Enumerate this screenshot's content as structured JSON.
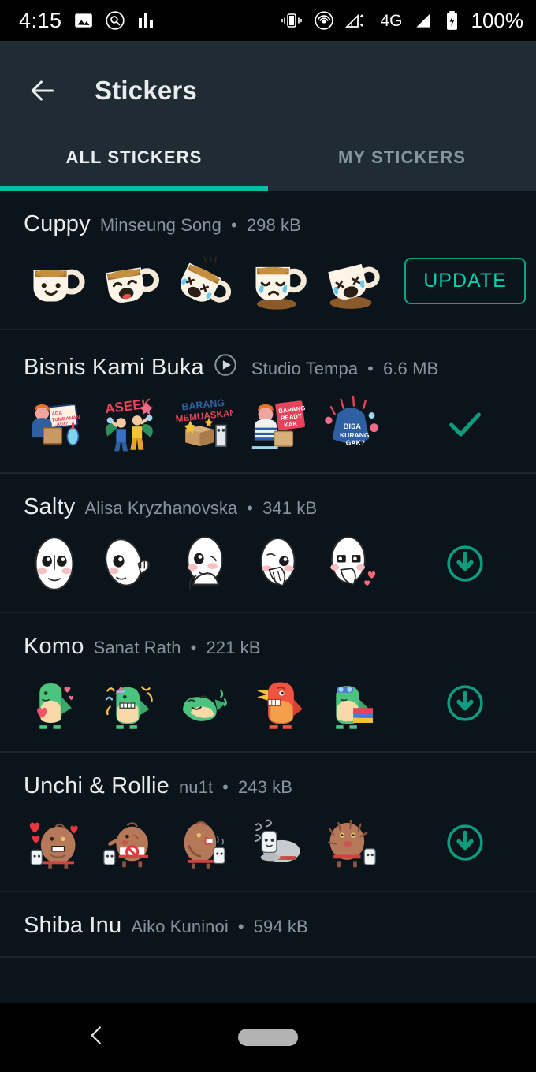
{
  "statusbar": {
    "time": "4:15",
    "battery_percent": "100%",
    "network_type": "4G",
    "left_icons": [
      "photo-icon",
      "search-circle-icon",
      "bar-chart-icon"
    ],
    "right_icons": [
      "vibrate-icon",
      "hotspot-icon",
      "signal-off-icon",
      "network-4g-label",
      "signal-bars-icon",
      "battery-charging-icon"
    ]
  },
  "appbar": {
    "back_icon": "arrow-left-icon",
    "title": "Stickers"
  },
  "tabs": {
    "active_index": 0,
    "items": [
      {
        "label": "ALL STICKERS"
      },
      {
        "label": "MY STICKERS"
      }
    ],
    "indicator_color": "#00bfa5"
  },
  "colors": {
    "background": "#0b141a",
    "appbar": "#1f2c34",
    "accent": "#00a884",
    "accent_bright": "#00d2b0",
    "title_text": "#e9edef",
    "meta_text": "#8696a0",
    "divider": "#1b262c"
  },
  "packs": [
    {
      "title": "Cuppy",
      "author": "Minseung Song",
      "size": "298 kB",
      "separator": "•",
      "animated": false,
      "action": "update",
      "action_label": "UPDATE",
      "stickers": [
        "cup-smiling",
        "cup-laughing",
        "cup-tipping",
        "cup-crying",
        "cup-spilled"
      ]
    },
    {
      "title": "Bisnis Kami Buka",
      "author": "Studio Tempa",
      "size": "6.6 MB",
      "separator": "•",
      "animated": true,
      "action": "added",
      "action_label": "",
      "stickers": [
        "ada-tumbahan-lagi",
        "aseek",
        "barang-memuaskan",
        "barang-ready-kak",
        "bisa-kurang-gak"
      ]
    },
    {
      "title": "Salty",
      "author": "Alisa Kryzhanovska",
      "size": "341 kB",
      "separator": "•",
      "animated": false,
      "action": "download",
      "action_label": "",
      "stickers": [
        "face-neutral",
        "face-waving",
        "face-thinking",
        "face-shy",
        "face-hearts"
      ]
    },
    {
      "title": "Komo",
      "author": "Sanat Rath",
      "size": "221 kB",
      "separator": "•",
      "animated": false,
      "action": "download",
      "action_label": "",
      "stickers": [
        "dino-love",
        "dino-party",
        "dino-rolling",
        "dino-angry-red",
        "dino-books"
      ]
    },
    {
      "title": "Unchi & Rollie",
      "author": "nu1t",
      "size": "243 kB",
      "separator": "•",
      "animated": false,
      "action": "download",
      "action_label": "",
      "stickers": [
        "unchi-hearts",
        "unchi-no-sign",
        "unchi-shouting",
        "rollie-sleeping",
        "unchi-shocked"
      ]
    },
    {
      "title": "Shiba Inu",
      "author": "Aiko Kuninoi",
      "size": "594 kB",
      "separator": "•",
      "animated": false,
      "action": "none",
      "action_label": "",
      "stickers": []
    }
  ],
  "navbar": {
    "back_icon": "chevron-left-icon",
    "home_pill": "home-pill-indicator"
  }
}
